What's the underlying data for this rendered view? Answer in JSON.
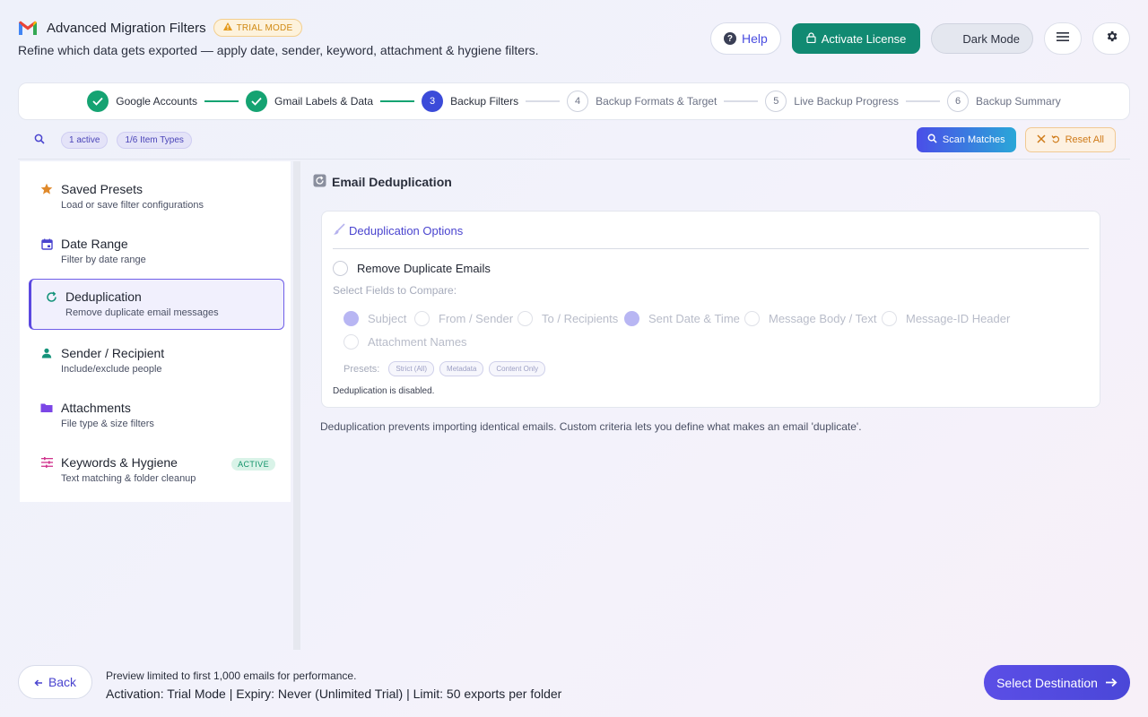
{
  "header": {
    "title": "Advanced Migration Filters",
    "trial_badge": "TRIAL MODE",
    "subtitle": "Refine which data gets exported — apply date, sender, keyword, attachment & hygiene filters.",
    "help_label": "Help",
    "license_label": "Activate License",
    "dark_mode_label": "Dark Mode"
  },
  "stepper": [
    {
      "num": "1",
      "label": "Google Accounts",
      "state": "done"
    },
    {
      "num": "2",
      "label": "Gmail Labels & Data",
      "state": "done"
    },
    {
      "num": "3",
      "label": "Backup Filters",
      "state": "current"
    },
    {
      "num": "4",
      "label": "Backup Formats & Target",
      "state": "future"
    },
    {
      "num": "5",
      "label": "Live Backup Progress",
      "state": "future"
    },
    {
      "num": "6",
      "label": "Backup Summary",
      "state": "future"
    }
  ],
  "toolbar": {
    "active_chip": "1 active",
    "item_types_chip": "1/6 Item Types",
    "scan_label": "Scan Matches",
    "reset_label": "Reset All"
  },
  "sidebar": {
    "items": [
      {
        "title": "Saved Presets",
        "sub": "Load or save filter configurations",
        "icon": "star-icon"
      },
      {
        "title": "Date Range",
        "sub": "Filter by date range",
        "icon": "calendar-icon"
      },
      {
        "title": "Deduplication",
        "sub": "Remove duplicate email messages",
        "icon": "refresh-icon"
      },
      {
        "title": "Sender / Recipient",
        "sub": "Include/exclude people",
        "icon": "person-icon"
      },
      {
        "title": "Attachments",
        "sub": "File type & size filters",
        "icon": "folder-icon"
      },
      {
        "title": "Keywords & Hygiene",
        "sub": "Text matching & folder cleanup",
        "icon": "sliders-icon",
        "tag": "ACTIVE"
      }
    ]
  },
  "main": {
    "title": "Email Deduplication",
    "card_heading": "Deduplication Options",
    "toggle_label": "Remove Duplicate Emails",
    "select_fields_label": "Select Fields to Compare:",
    "fields": [
      {
        "label": "Subject",
        "checked": true
      },
      {
        "label": "From / Sender",
        "checked": false
      },
      {
        "label": "To / Recipients",
        "checked": false
      },
      {
        "label": "Sent Date & Time",
        "checked": true
      },
      {
        "label": "Message Body / Text",
        "checked": false
      },
      {
        "label": "Message-ID Header",
        "checked": false
      },
      {
        "label": "Attachment Names",
        "checked": false
      }
    ],
    "presets_label": "Presets:",
    "presets": [
      "Strict (All)",
      "Metadata",
      "Content Only"
    ],
    "disabled_note": "Deduplication is disabled.",
    "footnote": "Deduplication prevents importing identical emails. Custom criteria lets you define what makes an email 'duplicate'."
  },
  "footer": {
    "back_label": "Back",
    "line1": "Preview limited to first 1,000 emails for performance.",
    "line2": "Activation: Trial Mode | Expiry: Never (Unlimited Trial) | Limit: 50 exports per folder",
    "destination_label": "Select Destination"
  },
  "colors": {
    "accent": "#4a44cf",
    "success": "#15a372",
    "license": "#118a72",
    "warning": "#d08a14"
  }
}
